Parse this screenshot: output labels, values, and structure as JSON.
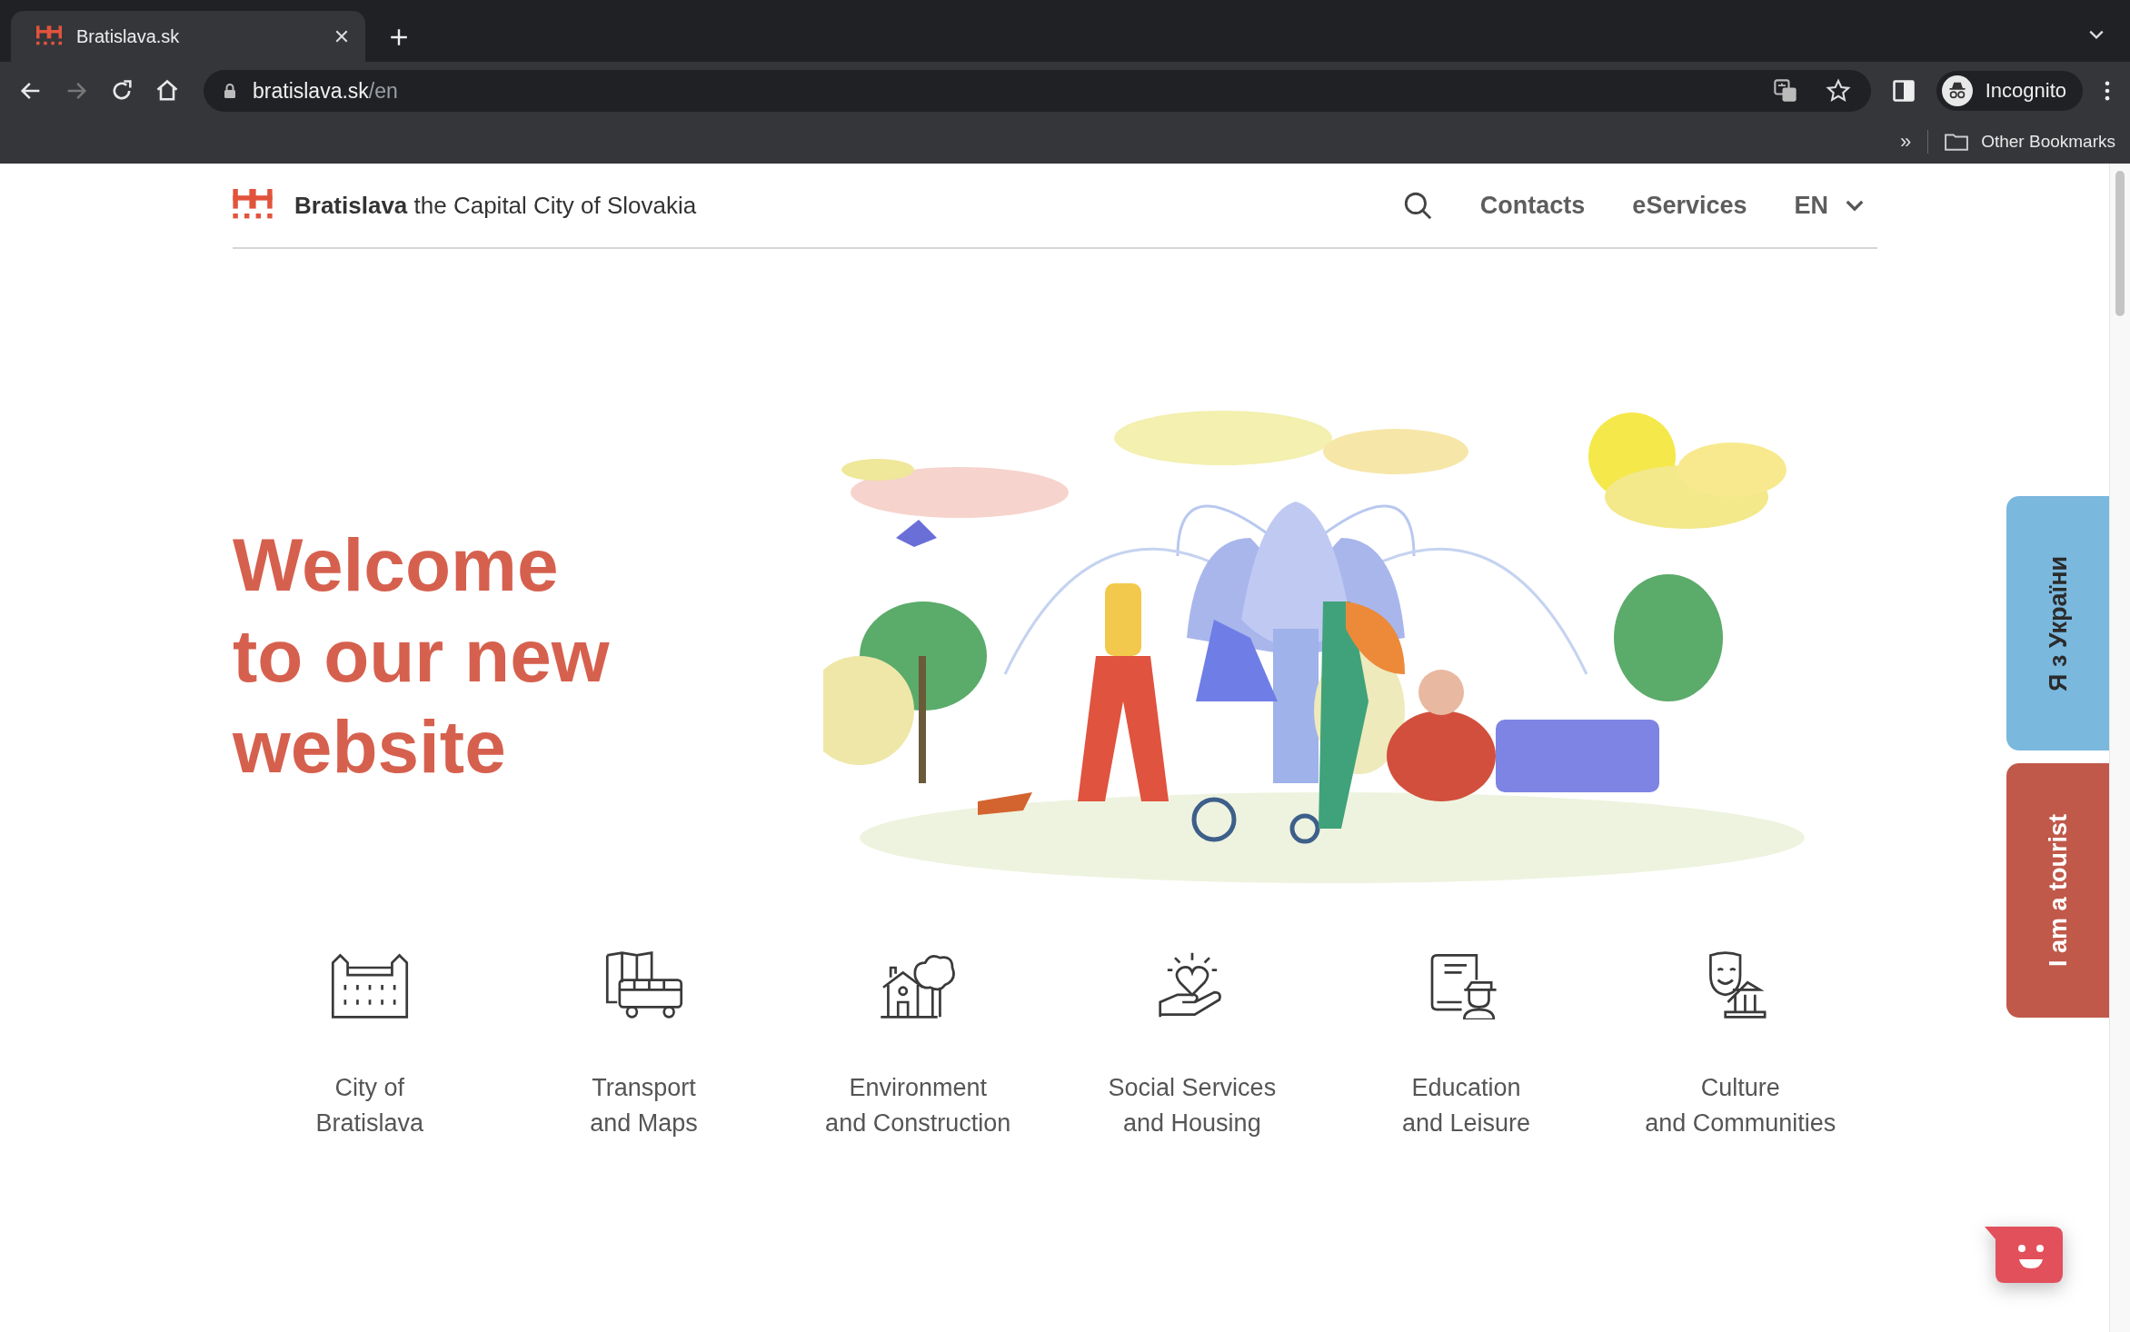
{
  "browser": {
    "tab_title": "Bratislava.sk",
    "url_host": "bratislava.sk",
    "url_path": "/en",
    "profile": "Incognito",
    "bookmarks_overflow": "»",
    "bookmarks_folder": "Other Bookmarks"
  },
  "header": {
    "brand": "**Bratislava** the Capital City of Slovakia",
    "nav": [
      "Contacts",
      "eServices"
    ],
    "language": "EN"
  },
  "hero": {
    "title": "Welcome\nto our new\nwebsite"
  },
  "categories": [
    {
      "kind": "castle",
      "label": "City of\nBratislava"
    },
    {
      "kind": "transport",
      "label": "Transport\nand Maps"
    },
    {
      "kind": "environment",
      "label": "Environment\nand Construction"
    },
    {
      "kind": "social",
      "label": "Social Services\nand Housing"
    },
    {
      "kind": "education",
      "label": "Education\nand Leisure"
    },
    {
      "kind": "culture",
      "label": "Culture\nand Communities"
    }
  ],
  "side_tabs": [
    {
      "label": "Я з України",
      "color": "#7ab8de"
    },
    {
      "label": "I am a tourist",
      "color": "#c0594a"
    }
  ]
}
